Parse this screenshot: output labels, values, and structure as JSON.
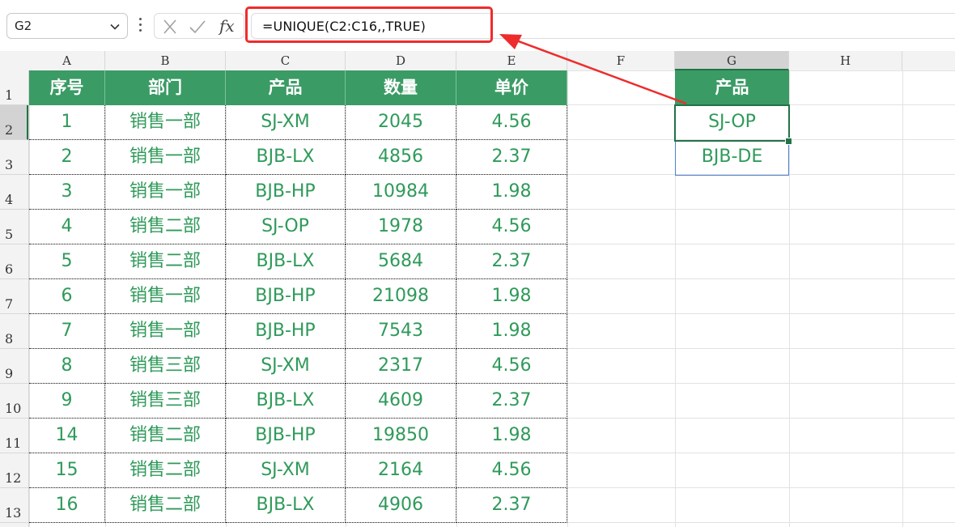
{
  "formula_bar": {
    "name_box": "G2",
    "fx_label": "fx",
    "formula": "=UNIQUE(C2:C16,,TRUE)"
  },
  "columns": [
    "A",
    "B",
    "C",
    "D",
    "E",
    "F",
    "G",
    "H"
  ],
  "rows": [
    "1",
    "2",
    "3",
    "4",
    "5",
    "6",
    "7",
    "8",
    "9",
    "10",
    "11",
    "12",
    "13"
  ],
  "table": {
    "headers": [
      "序号",
      "部门",
      "产品",
      "数量",
      "单价"
    ],
    "rows": [
      [
        "1",
        "销售一部",
        "SJ-XM",
        "2045",
        "4.56"
      ],
      [
        "2",
        "销售一部",
        "BJB-LX",
        "4856",
        "2.37"
      ],
      [
        "3",
        "销售一部",
        "BJB-HP",
        "10984",
        "1.98"
      ],
      [
        "4",
        "销售二部",
        "SJ-OP",
        "1978",
        "4.56"
      ],
      [
        "5",
        "销售二部",
        "BJB-LX",
        "5684",
        "2.37"
      ],
      [
        "6",
        "销售一部",
        "BJB-HP",
        "21098",
        "1.98"
      ],
      [
        "7",
        "销售一部",
        "BJB-HP",
        "7543",
        "1.98"
      ],
      [
        "8",
        "销售三部",
        "SJ-XM",
        "2317",
        "4.56"
      ],
      [
        "9",
        "销售三部",
        "BJB-LX",
        "4609",
        "2.37"
      ],
      [
        "14",
        "销售二部",
        "BJB-HP",
        "19850",
        "1.98"
      ],
      [
        "15",
        "销售二部",
        "SJ-XM",
        "2164",
        "4.56"
      ],
      [
        "16",
        "销售二部",
        "BJB-LX",
        "4906",
        "2.37"
      ]
    ]
  },
  "result": {
    "header": "产品",
    "values": [
      "SJ-OP",
      "BJB-DE"
    ]
  },
  "selected_cell": "G2",
  "colors": {
    "header_fill": "#3a9b65",
    "cell_text": "#2f9a5a",
    "highlight": "#ee2c2c",
    "selection": "#217346"
  }
}
